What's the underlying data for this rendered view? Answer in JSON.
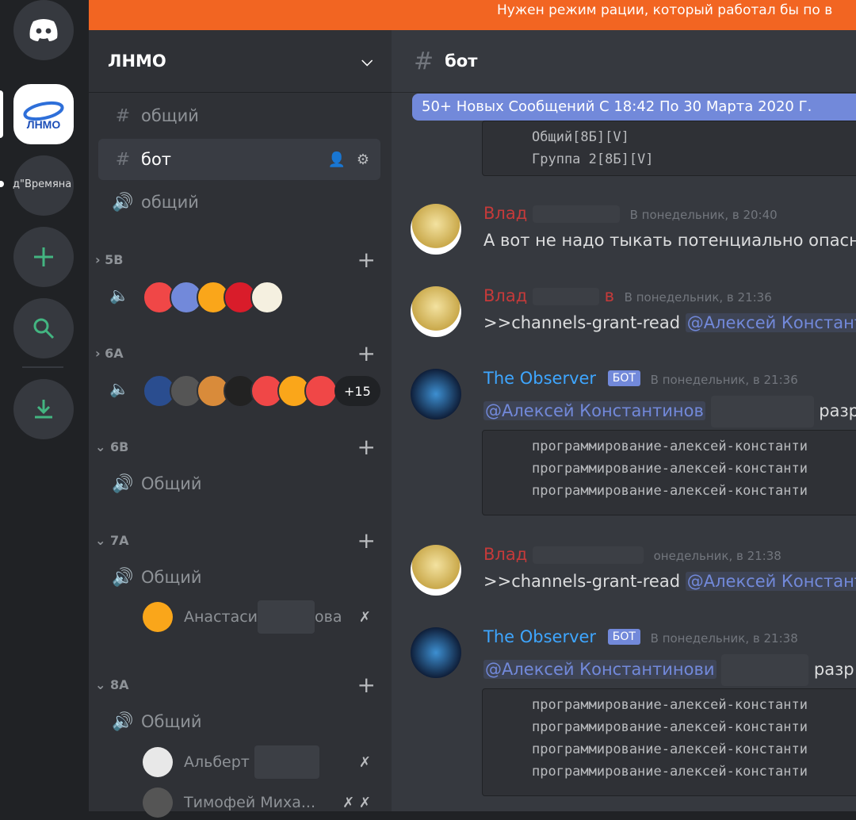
{
  "banner": {
    "text": "Нужен режим рации, который работал бы по в"
  },
  "rail": {
    "home_icon": "discord-logo-icon",
    "lnmo_label": "ЛНМО",
    "vremyana_label": "д\"Времяна",
    "add_icon": "plus-icon",
    "explore_icon": "search-icon",
    "download_icon": "download-icon"
  },
  "sidebar": {
    "server_name": "ЛНМО",
    "channels": [
      {
        "name": "общий",
        "type": "text"
      },
      {
        "name": "бот",
        "type": "text",
        "active": true
      },
      {
        "name": "общий",
        "type": "voice"
      }
    ],
    "categories": [
      {
        "name": "5В",
        "collapsed": true
      },
      {
        "name": "6А",
        "collapsed": true
      },
      {
        "name": "6В",
        "collapsed": false,
        "channel": "Общий"
      },
      {
        "name": "7А",
        "collapsed": false,
        "channel": "Общий",
        "users": [
          {
            "name_start": "Анастаси",
            "name_end": "ова"
          }
        ]
      },
      {
        "name": "8А",
        "collapsed": false,
        "channel": "Общий",
        "users": [
          {
            "name_start": "Альберт",
            "name_end": ""
          },
          {
            "name_start": "Тимофей Миха...",
            "name_end": ""
          }
        ]
      }
    ],
    "more_count": "+15"
  },
  "chat": {
    "channel_name": "бот",
    "new_messages_bar": "50+ Новых Сообщений С 18:42 По 30 Марта 2020 Г.",
    "code1": "Общий[8Б][V]\nГруппа 2[8Б][V]",
    "messages": [
      {
        "author": "Влад",
        "time": "В понедельник, в 20:40",
        "text": "А вот не надо тыкать потенциально опасны"
      },
      {
        "author": "Влад",
        "author_end": "в",
        "time": "В понедельник, в 21:36",
        "text": ">>channels-grant-read",
        "mention": "@Алексей Констант"
      },
      {
        "author": "The Observer",
        "bot_badge": "БОТ",
        "time": "В понедельник, в 21:36",
        "mention": "@Алексей Константинов",
        "text_after": "разр"
      },
      {
        "author": "Влад",
        "time": "онедельник, в 21:38",
        "text": ">>channels-grant-read",
        "mention": "@Алексей Констант"
      },
      {
        "author": "The Observer",
        "bot_badge": "БОТ",
        "time": "В понедельник, в 21:38",
        "mention": "@Алексей Константинови",
        "text_after": "разр"
      }
    ],
    "code2": "программирование-алексей-константи\nпрограммирование-алексей-константи\nпрограммирование-алексей-константи",
    "code3": "программирование-алексей-константи\nпрограммирование-алексей-константи\nпрограммирование-алексей-константи\nпрограммирование-алексей-константи"
  },
  "colors": {
    "accent": "#7289da",
    "banner": "#f26522",
    "danger": "#c53a3a",
    "bot_name": "#3ea6ff"
  }
}
